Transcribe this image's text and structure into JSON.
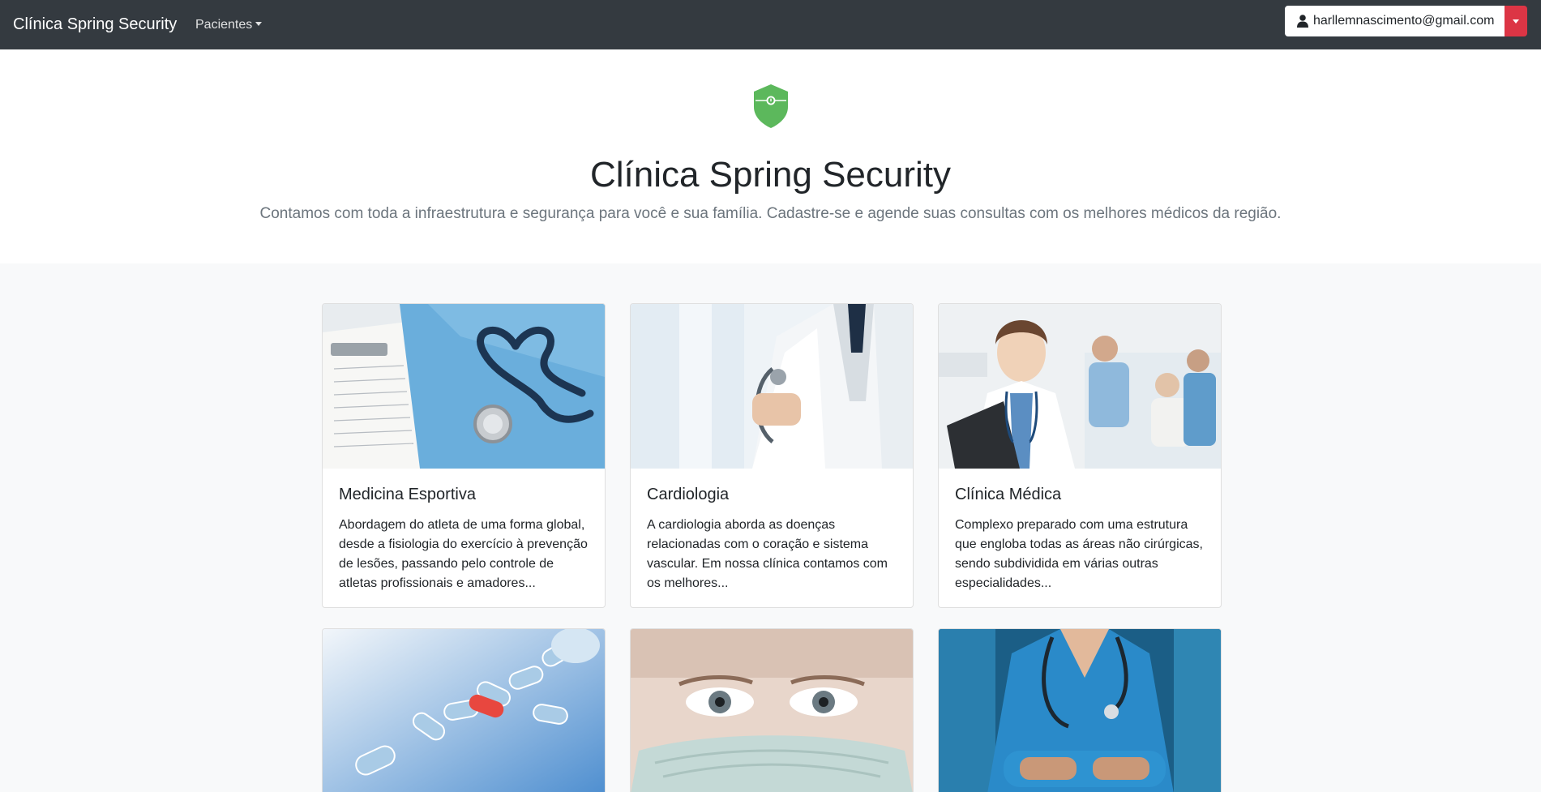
{
  "navbar": {
    "brand": "Clínica Spring Security",
    "menu_label": "Pacientes",
    "user_email": "harllemnascimento@gmail.com"
  },
  "hero": {
    "title": "Clínica Spring Security",
    "lead": "Contamos com toda a infraestrutura e segurança para você e sua família. Cadastre-se e agende suas consultas com os melhores médicos da região."
  },
  "colors": {
    "navbar": "#343a40",
    "danger": "#dc3545",
    "shield": "#5cb85c",
    "page_bg": "#f8f9fa"
  },
  "cards": [
    {
      "title": "Medicina Esportiva",
      "text": "Abordagem do atleta de uma forma global, desde a fisiologia do exercício à prevenção de lesões, passando pelo controle de atletas profissionais e amadores..."
    },
    {
      "title": "Cardiologia",
      "text": "A cardiologia aborda as doenças relacionadas com o coração e sistema vascular. Em nossa clínica contamos com os melhores..."
    },
    {
      "title": "Clínica Médica",
      "text": "Complexo preparado com uma estrutura que engloba todas as áreas não cirúrgicas, sendo subdividida em várias outras especialidades..."
    }
  ]
}
